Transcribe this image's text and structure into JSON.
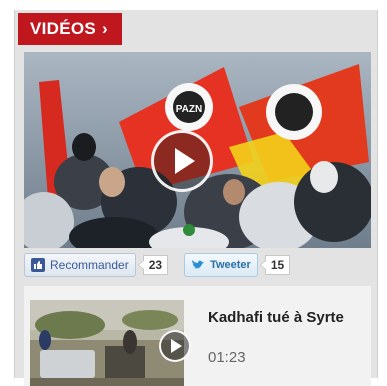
{
  "header": {
    "title": "VIDÉOS",
    "chevron": "›",
    "accent": "#c0171f"
  },
  "player": {
    "play_icon": "play-icon",
    "poster_sign": "PAZN"
  },
  "social": {
    "recommend_label": "Recommander",
    "recommend_count": "23",
    "tweet_label": "Tweeter",
    "tweet_count": "15"
  },
  "related": {
    "title": "Kadhafi tué à Syrte",
    "duration": "01:23"
  }
}
